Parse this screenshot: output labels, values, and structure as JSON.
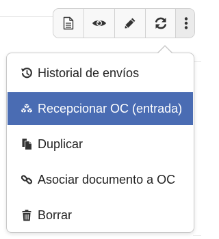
{
  "toolbar": {
    "buttons": [
      {
        "icon": "document-icon"
      },
      {
        "icon": "eye-icon"
      },
      {
        "icon": "pencil-icon"
      },
      {
        "icon": "refresh-icon"
      },
      {
        "icon": "kebab-menu-icon"
      }
    ]
  },
  "menu": {
    "items": [
      {
        "label": "Historial de envíos",
        "icon": "history-icon"
      },
      {
        "label": "Recepcionar OC (entrada)",
        "icon": "cubes-icon",
        "selected": true
      },
      {
        "label": "Duplicar",
        "icon": "copy-icon"
      },
      {
        "label": "Asociar documento a OC",
        "icon": "link-icon"
      },
      {
        "label": "Borrar",
        "icon": "trash-icon"
      }
    ]
  },
  "colors": {
    "selected_bg": "#4a6cb3",
    "selected_text": "#ffffff",
    "text": "#222222",
    "icon": "#333333"
  }
}
